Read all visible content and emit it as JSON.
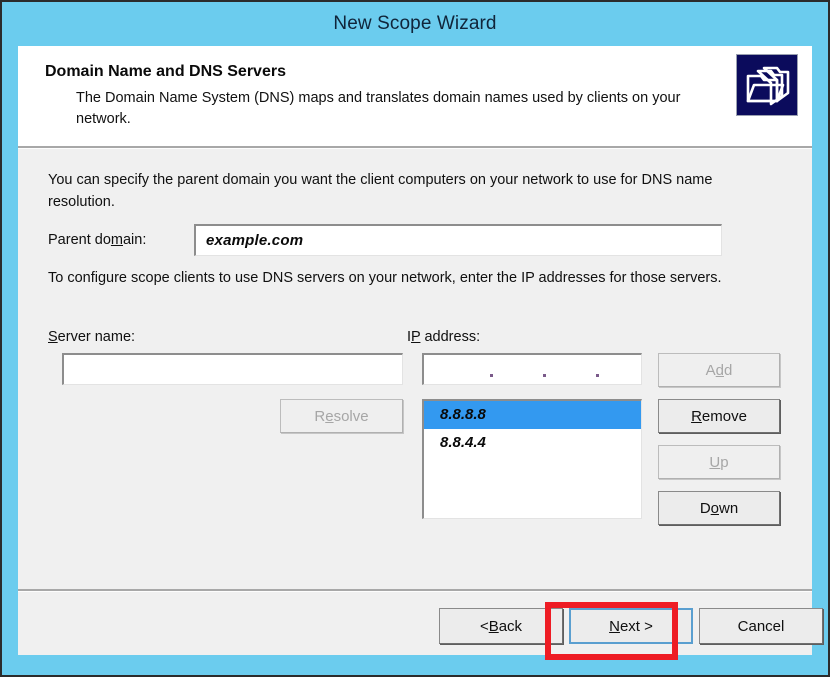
{
  "window": {
    "title": "New Scope Wizard",
    "title_bar_color": "#6bccee",
    "frame_border_color": "#2b2b2b"
  },
  "header": {
    "title": "Domain Name and DNS Servers",
    "description": "The Domain Name System (DNS) maps and translates domain names used by clients on your network.",
    "icon": "folders-icon",
    "icon_background": "#0b0b5c"
  },
  "content": {
    "intro_paragraph": "You can specify the parent domain you want the client computers on your network to use for DNS name resolution.",
    "dns_paragraph": "To configure scope clients to use DNS servers on your network, enter the IP addresses for those servers.",
    "parent_domain": {
      "label_pre": "Parent do",
      "label_accel": "m",
      "label_post": "ain:",
      "value": "example.com",
      "placeholder": ""
    },
    "server_name": {
      "label_accel": "S",
      "label_post": "erver name:",
      "value": "",
      "placeholder": ""
    },
    "ip_address": {
      "label_pre": "I",
      "label_accel": "P",
      "label_post": " address:",
      "value": "",
      "octet_separator": "."
    },
    "dns_server_list": {
      "items": [
        {
          "value": "8.8.8.8",
          "selected": true
        },
        {
          "value": "8.8.4.4",
          "selected": false
        }
      ],
      "selection_color": "#3399f0"
    },
    "buttons": {
      "resolve": {
        "pre": "R",
        "accel": "e",
        "post": "solve",
        "enabled": false
      },
      "add": {
        "pre": "A",
        "accel": "d",
        "post": "d",
        "enabled": false
      },
      "remove": {
        "pre": "",
        "accel": "R",
        "post": "emove",
        "enabled": true
      },
      "up": {
        "pre": "",
        "accel": "U",
        "post": "p",
        "enabled": false
      },
      "down": {
        "pre": "D",
        "accel": "o",
        "post": "wn",
        "enabled": true
      }
    }
  },
  "footer": {
    "back": {
      "pre": "< ",
      "accel": "B",
      "post": "ack"
    },
    "next": {
      "pre": "",
      "accel": "N",
      "post": "ext >",
      "is_default": true
    },
    "cancel": {
      "pre": "Cancel",
      "accel": "",
      "post": ""
    }
  },
  "annotation": {
    "target": "next-button",
    "color": "#ee1c24"
  }
}
